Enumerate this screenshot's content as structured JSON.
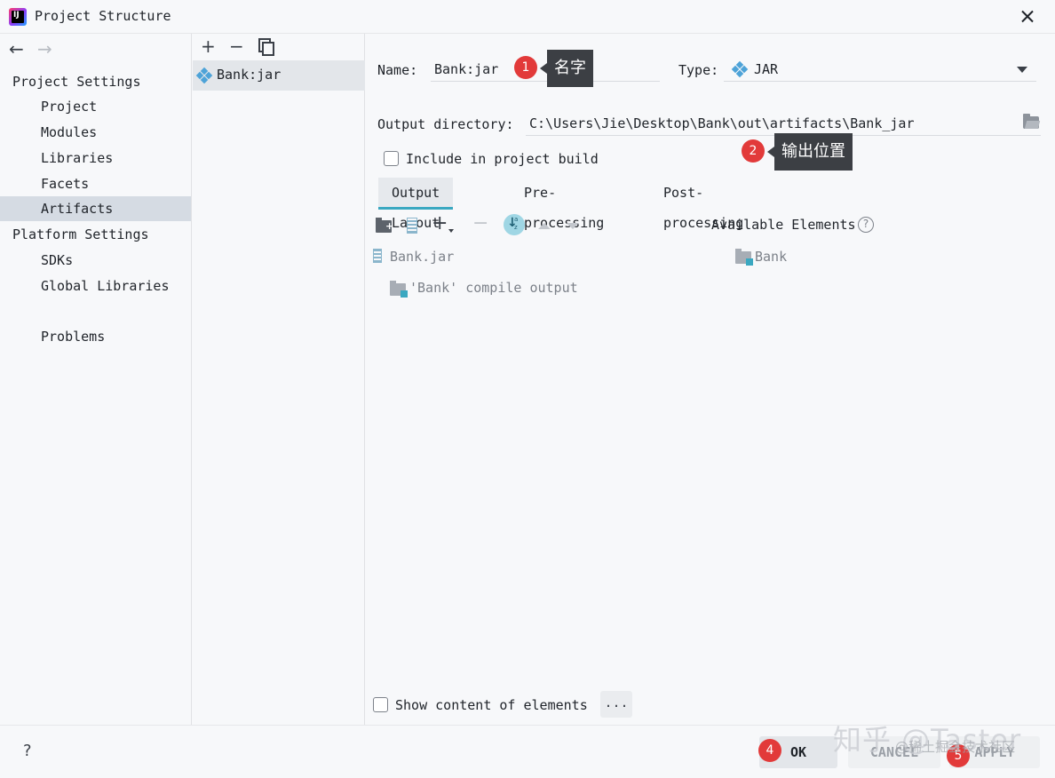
{
  "window": {
    "title": "Project Structure",
    "app_icon_text": "IJ"
  },
  "nav": {
    "back_glyph": "←",
    "forward_glyph": "→",
    "project_settings_heading": "Project Settings",
    "project_settings_items": [
      "Project",
      "Modules",
      "Libraries",
      "Facets",
      "Artifacts"
    ],
    "selected_item": "Artifacts",
    "platform_settings_heading": "Platform Settings",
    "platform_settings_items": [
      "SDKs",
      "Global Libraries"
    ],
    "problems": "Problems"
  },
  "artifacts_list": {
    "add_glyph": "+",
    "remove_glyph": "−",
    "items": [
      "Bank:jar"
    ]
  },
  "detail": {
    "name_label": "Name:",
    "name_value": "Bank:jar",
    "type_label": "Type:",
    "type_value": "JAR",
    "output_dir_label": "Output directory:",
    "output_dir_value": "C:\\Users\\Jie\\Desktop\\Bank\\out\\artifacts\\Bank_jar",
    "include_label": "Include in project build",
    "tabs": [
      "Output Layout",
      "Pre-processing",
      "Post-processing"
    ],
    "active_tab": "Output Layout",
    "add_glyph": "+",
    "remove_glyph": "−",
    "available_elements_label": "Available Elements",
    "help_glyph": "?",
    "layout_tree": {
      "root": "Bank.jar",
      "child": "'Bank' compile output"
    },
    "available_tree": [
      "Bank"
    ],
    "show_content_label": "Show content of elements",
    "more_button": "..."
  },
  "annotations": [
    {
      "number": "1",
      "text": "名字"
    },
    {
      "number": "2",
      "text": "输出位置"
    },
    {
      "number": "4",
      "text": ""
    },
    {
      "number": "5",
      "text": ""
    }
  ],
  "footer": {
    "help": "?",
    "ok": "OK",
    "cancel": "CANCEL",
    "apply": "APPLY"
  },
  "watermark": {
    "main": "知乎 @Taster",
    "sub": "@稀土掘金技术社区"
  },
  "colors": {
    "selection": "#d5dbe3",
    "tab_underline": "#3aa8c1",
    "badge": "#e23a3a",
    "callout": "#3c3f44",
    "artifact_icon": "#4ea3d8"
  }
}
